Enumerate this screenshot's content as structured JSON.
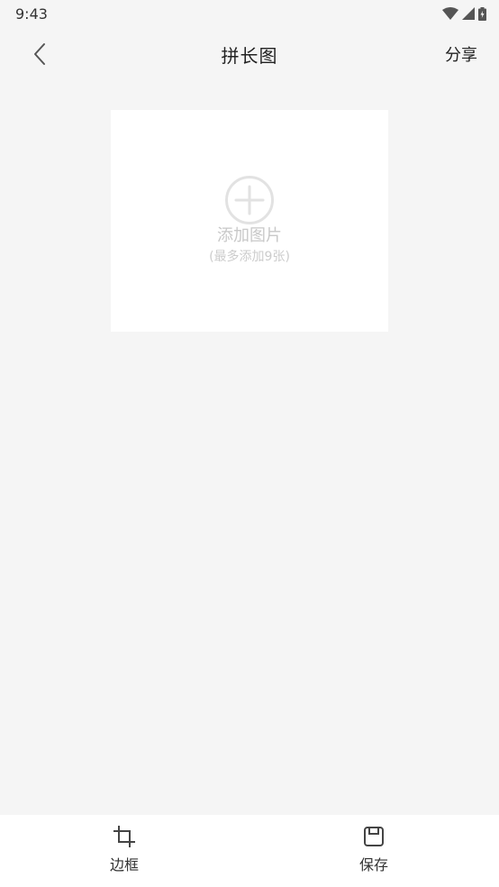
{
  "status_bar": {
    "time": "9:43",
    "icons": [
      "wifi-icon",
      "cellular-signal-icon",
      "battery-icon"
    ]
  },
  "app_bar": {
    "back_icon": "chevron-left-icon",
    "title": "拼长图",
    "share_label": "分享"
  },
  "add_card": {
    "icon": "plus-circle-icon",
    "label": "添加图片",
    "hint": "(最多添加9张)"
  },
  "toolbar": {
    "border_label": "边框",
    "border_icon": "crop-icon",
    "save_label": "保存",
    "save_icon": "save-icon"
  },
  "colors": {
    "background": "#f5f5f5",
    "card": "#ffffff",
    "placeholder_text": "#c8c8c8",
    "primary_text": "#222222"
  }
}
